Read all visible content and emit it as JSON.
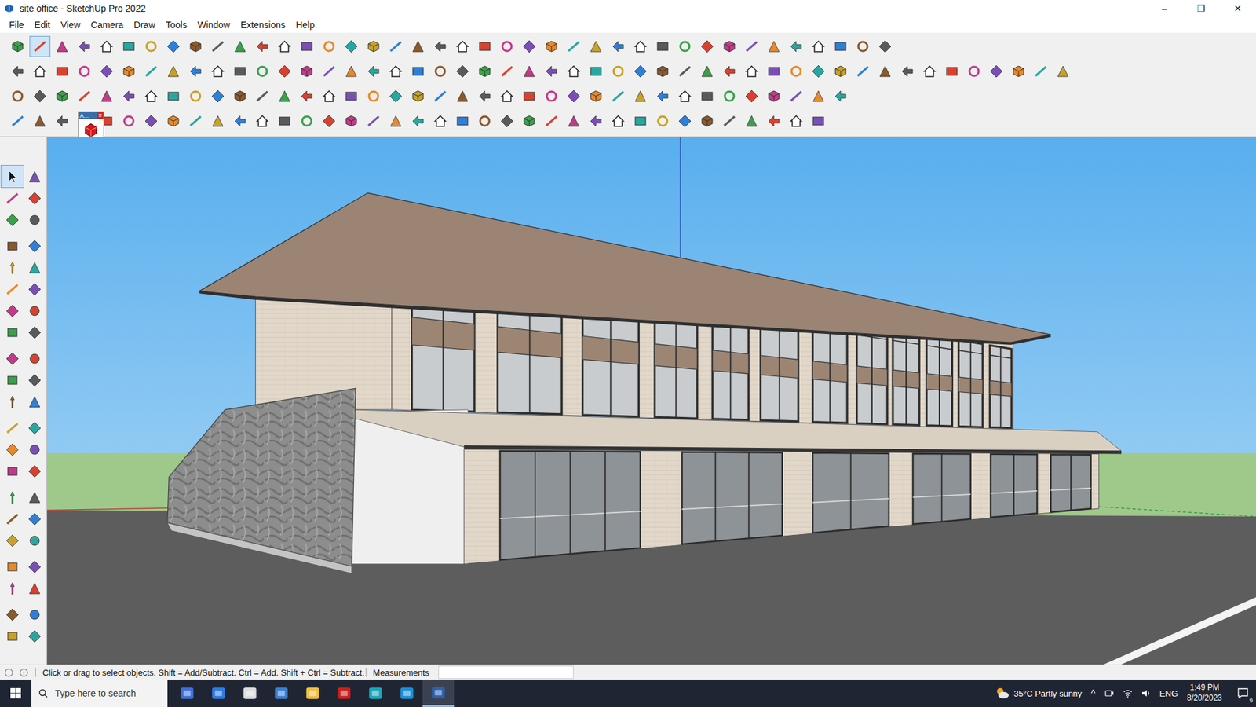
{
  "window": {
    "title": "site office - SketchUp Pro 2022",
    "controls": [
      "–",
      "❐",
      "✕"
    ]
  },
  "menu": [
    "File",
    "Edit",
    "View",
    "Camera",
    "Draw",
    "Tools",
    "Window",
    "Extensions",
    "Help"
  ],
  "toolbar": {
    "select_active": true,
    "popup": {
      "label": "A...",
      "close": "×"
    }
  },
  "tool_palette": [
    [
      {
        "selected": true
      },
      {
        "selected": false
      },
      {
        "selected": false
      },
      {
        "selected": false
      },
      {
        "selected": false
      },
      {
        "selected": false
      }
    ],
    [
      {
        "selected": false
      },
      {
        "selected": false
      },
      {
        "selected": false
      },
      {
        "selected": false
      },
      {
        "selected": false
      },
      {
        "selected": false
      },
      {
        "selected": false
      },
      {
        "selected": false
      },
      {
        "selected": false
      },
      {
        "selected": false
      }
    ],
    [
      {
        "selected": false
      },
      {
        "selected": false
      },
      {
        "selected": false
      },
      {
        "selected": false
      },
      {
        "selected": false
      },
      {
        "selected": false
      }
    ],
    [
      {
        "selected": false
      },
      {
        "selected": false
      },
      {
        "selected": false
      },
      {
        "selected": false
      },
      {
        "selected": false
      },
      {
        "selected": false
      }
    ],
    [
      {
        "selected": false
      },
      {
        "selected": false
      },
      {
        "selected": false
      },
      {
        "selected": false
      },
      {
        "selected": false
      },
      {
        "selected": false
      }
    ],
    [
      {
        "selected": false
      },
      {
        "selected": false
      },
      {
        "selected": false
      },
      {
        "selected": false
      }
    ],
    [
      {
        "selected": false
      },
      {
        "selected": false
      },
      {
        "selected": false
      },
      {
        "selected": false
      }
    ]
  ],
  "status_bar": {
    "hint": "Click or drag to select objects. Shift = Add/Subtract. Ctrl = Add. Shift + Ctrl = Subtract.",
    "measurements_label": "Measurements"
  },
  "taskbar": {
    "search_placeholder": "Type here to search",
    "weather": "35°C Partly sunny",
    "tray_arrow": "^",
    "language": "ENG",
    "time": "1:49 PM",
    "date": "8/20/2023",
    "notifications": "9",
    "active_app": 7
  }
}
